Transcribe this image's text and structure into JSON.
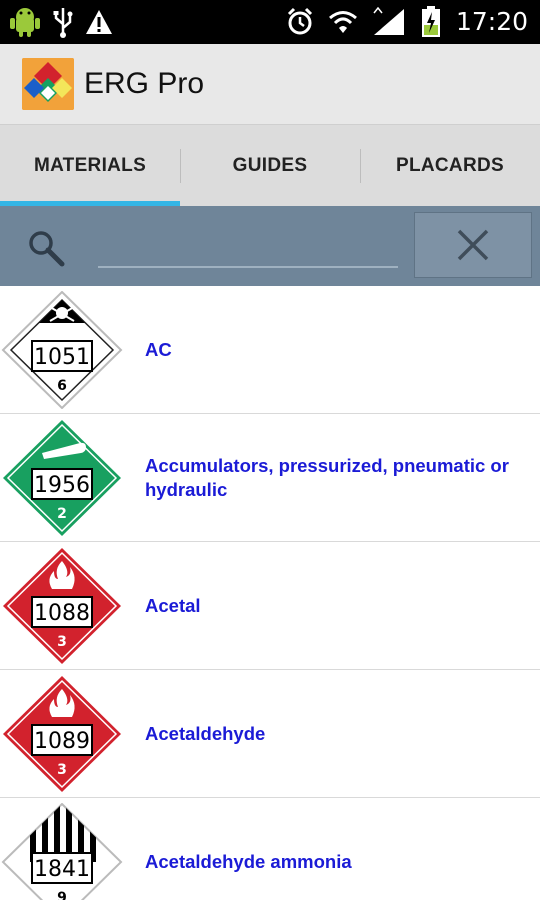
{
  "status_bar": {
    "time": "17:20",
    "left_icons": [
      "android-debug-icon",
      "usb-icon",
      "warning-icon"
    ],
    "right_icons": [
      "alarm-icon",
      "wifi-icon",
      "signal-icon",
      "battery-charging-icon"
    ]
  },
  "app": {
    "title": "ERG Pro",
    "logo_icon": "erg-app-logo-icon"
  },
  "tabs": [
    {
      "label": "MATERIALS",
      "selected": true
    },
    {
      "label": "GUIDES",
      "selected": false
    },
    {
      "label": "PLACARDS",
      "selected": false
    }
  ],
  "colors": {
    "tab_indicator": "#33b5e5",
    "search_bg": "#6f8599",
    "link_text": "#1b1bd6",
    "placard_red": "#d2222d",
    "placard_green": "#18a060",
    "placard_black": "#000000"
  },
  "search": {
    "value": "",
    "placeholder": "",
    "clear_icon": "close-icon"
  },
  "materials": [
    {
      "id": "1051",
      "class": "6",
      "name": "AC",
      "placard_color": "white",
      "symbol": "skull-crossbones-icon"
    },
    {
      "id": "1956",
      "class": "2",
      "name": "Accumulators, pressurized, pneumatic or hydraulic",
      "placard_color": "green",
      "symbol": "gas-cylinder-icon"
    },
    {
      "id": "1088",
      "class": "3",
      "name": "Acetal",
      "placard_color": "red",
      "symbol": "flame-icon"
    },
    {
      "id": "1089",
      "class": "3",
      "name": "Acetaldehyde",
      "placard_color": "red",
      "symbol": "flame-icon"
    },
    {
      "id": "1841",
      "class": "9",
      "name": "Acetaldehyde ammonia",
      "placard_color": "striped",
      "symbol": "class9-stripes-icon"
    }
  ]
}
